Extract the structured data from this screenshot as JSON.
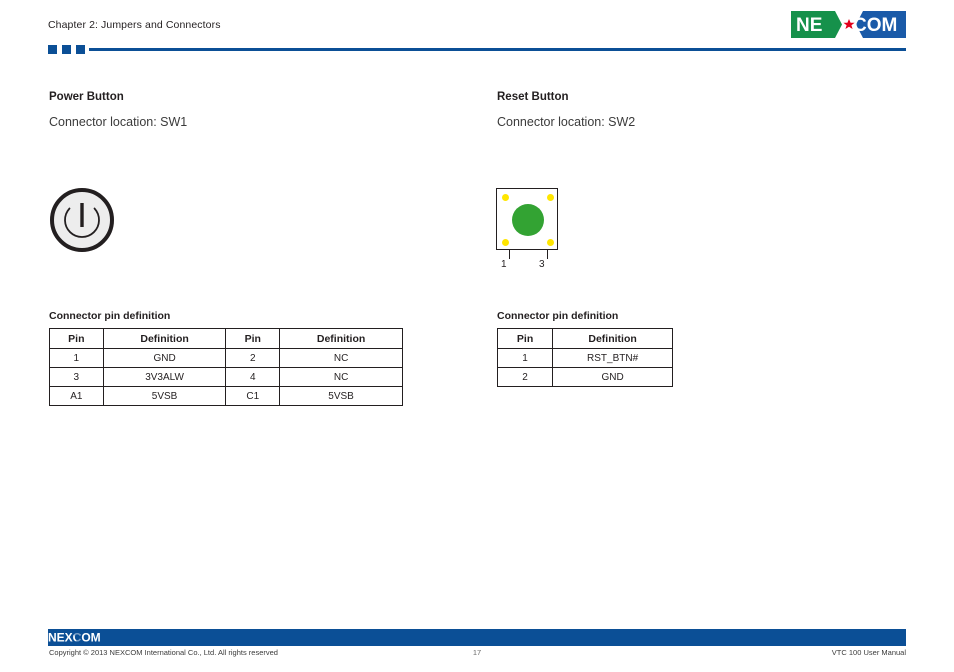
{
  "header": {
    "chapter": "Chapter 2: Jumpers and Connectors",
    "logo_text_left": "NE",
    "logo_text_right": "COM",
    "accent_color": "#0b4f96",
    "logo_green": "#16914b",
    "logo_blue": "#1a5aa8",
    "logo_star_color": "#e3001b"
  },
  "left_section": {
    "title": "Power Button",
    "subtitle": "Connector location: SW1",
    "figure": {
      "type": "power-symbol",
      "ring_color": "#231f20",
      "fill_color": "#ededed"
    },
    "table_caption": "Connector pin definition",
    "table": {
      "headers": [
        "Pin",
        "Definition",
        "Pin",
        "Definition"
      ],
      "rows": [
        [
          "1",
          "GND",
          "2",
          "NC"
        ],
        [
          "3",
          "3V3ALW",
          "4",
          "NC"
        ],
        [
          "A1",
          "5VSB",
          "C1",
          "5VSB"
        ]
      ]
    }
  },
  "right_section": {
    "title": "Reset Button",
    "subtitle": "Connector location: SW2",
    "figure": {
      "type": "tact-switch",
      "body_color": "#ffffff",
      "border_color": "#231f20",
      "pad_color": "#ffe600",
      "button_color": "#33a333",
      "pin_labels": [
        "1",
        "3"
      ]
    },
    "table_caption": "Connector pin definition",
    "table": {
      "headers": [
        "Pin",
        "Definition"
      ],
      "rows": [
        [
          "1",
          "RST_BTN#"
        ],
        [
          "2",
          "GND"
        ]
      ]
    }
  },
  "footer": {
    "logo_text": "NEXCOM",
    "copyright": "Copyright © 2013 NEXCOM International Co., Ltd. All rights reserved",
    "page_number": "17",
    "manual_title": "VTC 100 User Manual",
    "bar_color": "#0b4f96"
  }
}
